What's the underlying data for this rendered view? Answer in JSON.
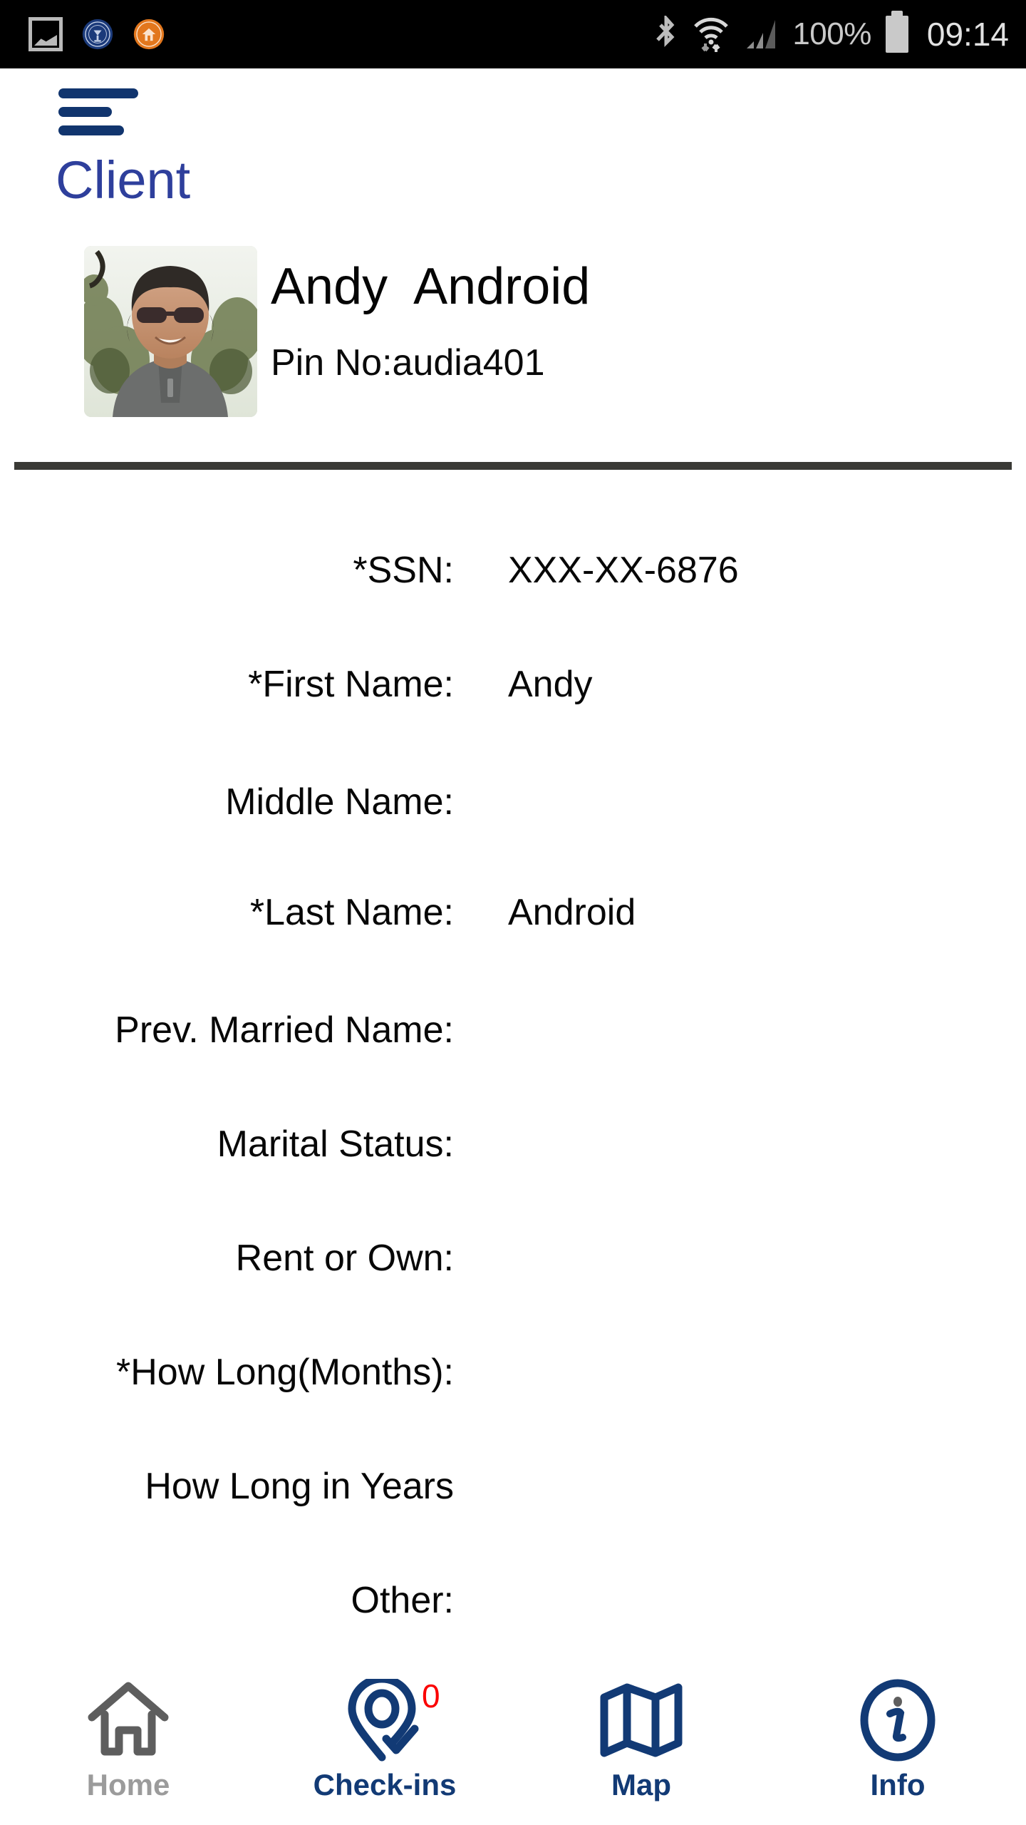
{
  "status_bar": {
    "notification_icons": [
      "screenshot-icon",
      "ecell-blue-logo-icon",
      "ecell-orange-logo-icon"
    ],
    "bluetooth_icon": "bluetooth-icon",
    "wifi_icon": "wifi-icon",
    "signal_icon": "signal-bars-icon",
    "battery_percent": "100%",
    "battery_icon": "battery-full-icon",
    "clock": "09:14"
  },
  "header": {
    "menu_icon": "hamburger-menu-icon",
    "title": "Client",
    "title_color": "#2e3f9c"
  },
  "profile": {
    "avatar_alt": "client-photo",
    "name": "Andy  Android",
    "pin_label": "Pin No:audia401"
  },
  "form": {
    "rows": [
      {
        "label": "*SSN:",
        "value": "XXX-XX-6876"
      },
      {
        "label": "*First Name:",
        "value": "Andy"
      },
      {
        "label": "Middle Name:",
        "value": ""
      },
      {
        "label": "*Last Name:",
        "value": "Android"
      },
      {
        "label": "Prev. Married Name:",
        "value": ""
      },
      {
        "label": "Marital Status:",
        "value": ""
      },
      {
        "label": "Rent or Own:",
        "value": ""
      },
      {
        "label": "*How Long(Months):",
        "value": ""
      },
      {
        "label": "How Long in Years",
        "value": ""
      },
      {
        "label": "Other:",
        "value": ""
      }
    ]
  },
  "bottom_nav": {
    "active_color": "#123a75",
    "inactive_color": "#9b9b9b",
    "badge_color": "#fb0000",
    "items": [
      {
        "label": "Home",
        "icon": "home-icon",
        "state": "inactive",
        "badge": ""
      },
      {
        "label": "Check-ins",
        "icon": "map-pin-check-icon",
        "state": "active",
        "badge": "0"
      },
      {
        "label": "Map",
        "icon": "folded-map-icon",
        "state": "active",
        "badge": ""
      },
      {
        "label": "Info",
        "icon": "info-circle-icon",
        "state": "active",
        "badge": ""
      }
    ]
  }
}
